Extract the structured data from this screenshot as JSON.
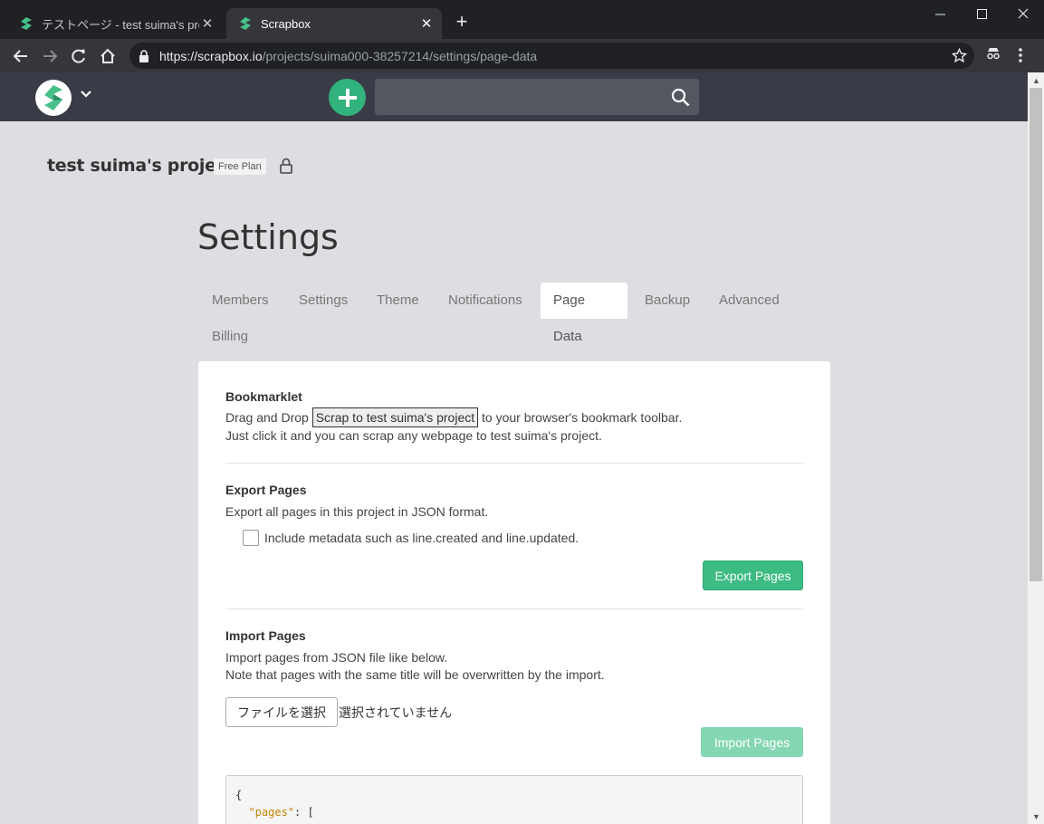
{
  "browser": {
    "tabs": [
      {
        "label": "テストページ - test suima's project"
      },
      {
        "label": "Scrapbox"
      }
    ],
    "url_host": "https://scrapbox.io",
    "url_path": "/projects/suima000-38257214/settings/page-data"
  },
  "project": {
    "name": "test suima's project",
    "plan": "Free Plan"
  },
  "page_title": "Settings",
  "nav_tabs": [
    "Members",
    "Settings",
    "Theme",
    "Notifications",
    "Page Data",
    "Backup",
    "Advanced",
    "Billing"
  ],
  "active_tab": "Page Data",
  "bookmarklet": {
    "heading": "Bookmarklet",
    "prefix": "Drag and Drop",
    "link_label": "Scrap to test suima's project",
    "suffix": "to your browser's bookmark toolbar.",
    "line2": "Just click it and you can scrap any webpage to test suima's project."
  },
  "export": {
    "heading": "Export Pages",
    "description": "Export all pages in this project in JSON format.",
    "checkbox_label": "Include metadata such as line.created and line.updated.",
    "button_label": "Export Pages"
  },
  "import": {
    "heading": "Import Pages",
    "line1": "Import pages from JSON file like below.",
    "line2": "Note that pages with the same title will be overwritten by the import.",
    "file_button": "ファイルを選択",
    "file_status": "選択されていません",
    "button_label": "Import Pages",
    "code_line1": "{",
    "code_key": "\"pages\"",
    "code_rest": ": ["
  },
  "colors": {
    "accent": "#3cbb83",
    "header": "#393c47"
  }
}
